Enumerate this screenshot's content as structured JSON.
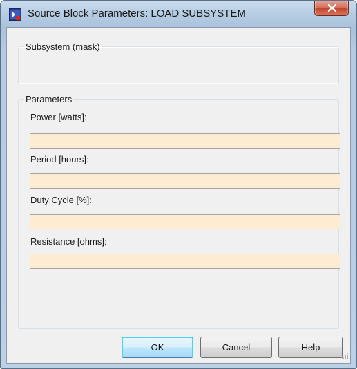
{
  "window": {
    "title": "Source Block Parameters: LOAD SUBSYSTEM",
    "close_icon": "close-icon",
    "app_icon": "simulink-block-icon"
  },
  "mask_group": {
    "title": "Subsystem (mask)"
  },
  "parameters_group": {
    "title": "Parameters",
    "fields": [
      {
        "label": "Power [watts]:",
        "value": ""
      },
      {
        "label": "Period [hours]:",
        "value": ""
      },
      {
        "label": "Duty Cycle [%]:",
        "value": ""
      },
      {
        "label": "Resistance [ohms]:",
        "value": ""
      }
    ]
  },
  "buttons": {
    "ok": "OK",
    "cancel": "Cancel",
    "help": "Help"
  },
  "colors": {
    "input_background": "#fdebd2",
    "dialog_background": "#f0f0f0",
    "close_button": "#c2442c"
  }
}
